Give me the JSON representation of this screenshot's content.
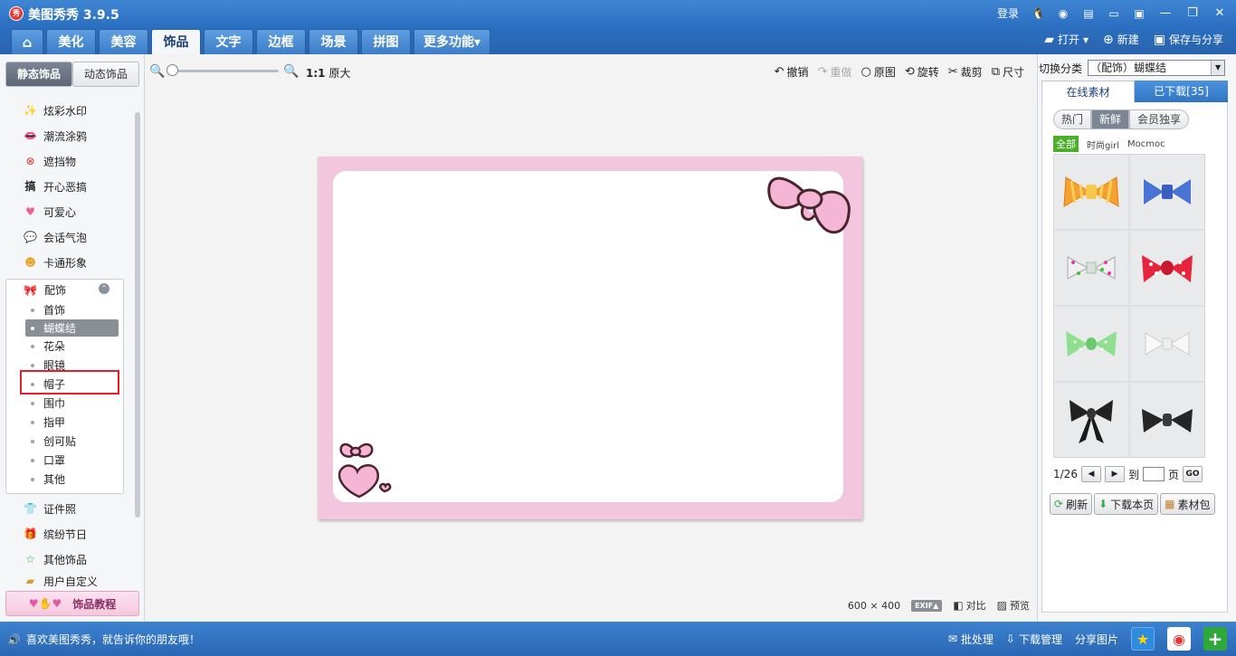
{
  "titlebar": {
    "app_name": "美图秀秀 3.9.5",
    "login": "登录"
  },
  "tabs": [
    {
      "label": "美化"
    },
    {
      "label": "美容"
    },
    {
      "label": "饰品"
    },
    {
      "label": "文字"
    },
    {
      "label": "边框"
    },
    {
      "label": "场景"
    },
    {
      "label": "拼图"
    },
    {
      "label": "更多功能▾"
    }
  ],
  "tab_actions": {
    "open": "打开",
    "new": "新建",
    "save_share": "保存与分享"
  },
  "left": {
    "tab_static": "静态饰品",
    "tab_dynamic": "动态饰品",
    "categories": [
      "炫彩水印",
      "潮流涂鸦",
      "遮挡物",
      "开心恶搞",
      "可爱心",
      "会话气泡",
      "卡通形象"
    ],
    "expanded": {
      "label": "配饰",
      "items": [
        "首饰",
        "蝴蝶结",
        "花朵",
        "眼镜",
        "帽子",
        "围巾",
        "指甲",
        "创可贴",
        "口罩",
        "其他"
      ]
    },
    "categories_after": [
      "证件照",
      "缤纷节日",
      "其他饰品",
      "用户自定义"
    ],
    "tutorial": "饰品教程"
  },
  "toolbar": {
    "ratio_mark": "1:1",
    "ratio_label": "原大",
    "undo": "撤销",
    "redo": "重做",
    "original": "原图",
    "rotate": "旋转",
    "crop": "裁剪",
    "size": "尺寸"
  },
  "canvas": {
    "width": "600",
    "times": "×",
    "height": "400",
    "exif": "EXIF▲",
    "compare": "对比",
    "preview": "预览"
  },
  "right": {
    "switch_label": "切换分类",
    "category_select": "（配饰）蝴蝶结",
    "tab_online": "在线素材",
    "tab_downloaded": "已下载[35]",
    "pills": [
      "热门",
      "新鲜",
      "会员独享"
    ],
    "filters": [
      "全部",
      "时尚girl",
      "Mocmoc"
    ],
    "pager": {
      "page": "1/26",
      "to": "到",
      "page_unit": "页",
      "go": "GO"
    },
    "buttons": {
      "refresh": "刷新",
      "download_page": "下载本页",
      "material_pack": "素材包"
    }
  },
  "statusbar": {
    "share_message": "喜欢美图秀秀，就告诉你的朋友哦！",
    "batch": "批处理",
    "download_mgr": "下载管理",
    "share_image": "分享图片"
  },
  "colors": {
    "accent": "#2b6fc0",
    "frame_pink": "#f2c6dc",
    "highlight_red": "#e0202a"
  }
}
